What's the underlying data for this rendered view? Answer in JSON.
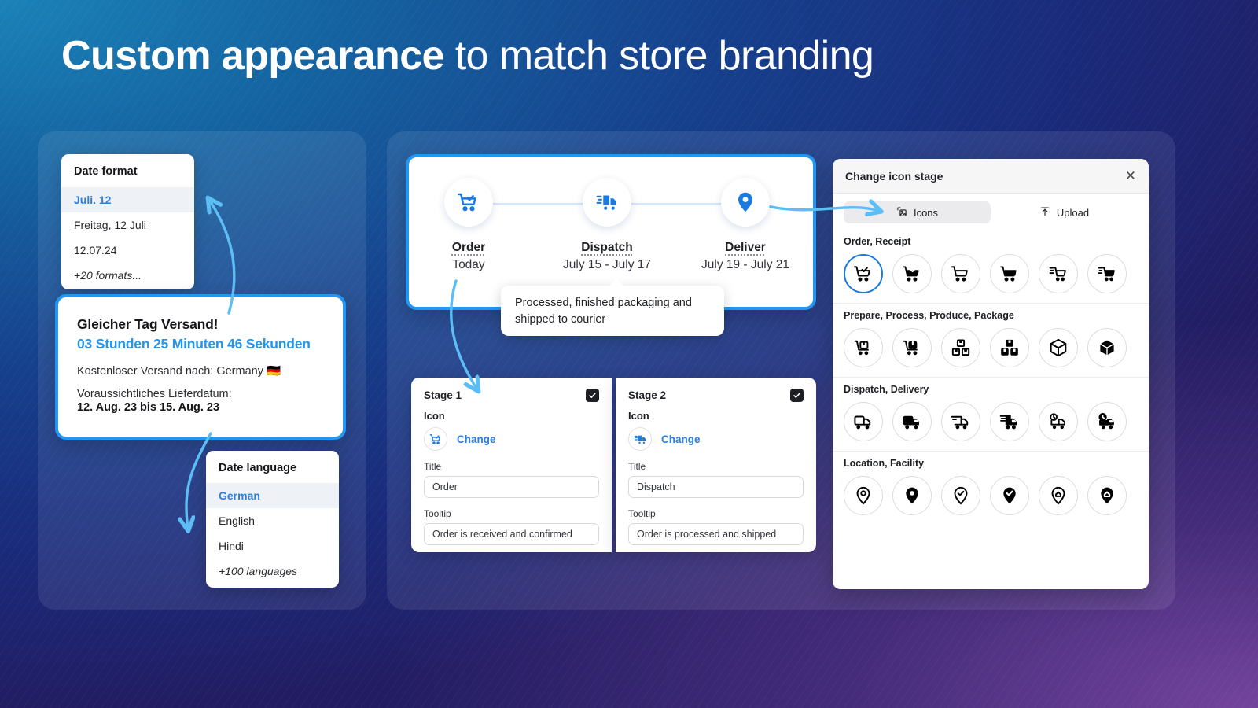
{
  "headline": {
    "bold": "Custom appearance",
    "rest": " to match store branding"
  },
  "colors": {
    "accent_blue": "#2196f3",
    "link_blue": "#2a7fe0",
    "arrow_blue": "#5dbdf5",
    "dark_text": "#1d1f24"
  },
  "date_format": {
    "title": "Date format",
    "options": [
      {
        "label": "Juli. 12",
        "selected": true
      },
      {
        "label": "Freitag, 12 Juli",
        "selected": false
      },
      {
        "label": "12.07.24",
        "selected": false
      },
      {
        "label": "+20 formats...",
        "selected": false
      }
    ]
  },
  "shipping_banner": {
    "heading": "Gleicher Tag Versand!",
    "timer": "03 Stunden 25  Minuten 46 Sekunden",
    "free_shipping": "Kostenloser Versand nach: Germany 🇩🇪",
    "delivery_label": "Voraussichtliches Lieferdatum:",
    "delivery_dates": "12. Aug. 23 bis 15. Aug. 23"
  },
  "date_language": {
    "title": "Date language",
    "options": [
      {
        "label": "German",
        "selected": true
      },
      {
        "label": "English",
        "selected": false
      },
      {
        "label": "Hindi",
        "selected": false
      },
      {
        "label": "+100 languages",
        "selected": false
      }
    ]
  },
  "timeline": {
    "stages": [
      {
        "icon": "cart-check-icon",
        "label": "Order",
        "date": "Today"
      },
      {
        "icon": "delivery-truck-icon",
        "label": "Dispatch",
        "date": "July 15 - July 17"
      },
      {
        "icon": "location-pin-icon",
        "label": "Deliver",
        "date": "July 19 - July 21"
      }
    ],
    "tooltip": "Processed, finished packaging and shipped to courier"
  },
  "stage_editor": [
    {
      "header": "Stage 1",
      "enabled": true,
      "icon_label": "Icon",
      "icon_name": "cart-check-icon",
      "change_label": "Change",
      "title_label": "Title",
      "title_value": "Order",
      "tooltip_label": "Tooltip",
      "tooltip_value": "Order is received and confirmed"
    },
    {
      "header": "Stage 2",
      "enabled": true,
      "icon_label": "Icon",
      "icon_name": "delivery-truck-icon",
      "change_label": "Change",
      "title_label": "Title",
      "title_value": "Dispatch",
      "tooltip_label": "Tooltip",
      "tooltip_value": "Order is processed and shipped"
    }
  ],
  "icon_modal": {
    "title": "Change icon stage",
    "close_label": "✕",
    "tabs": [
      {
        "label": "Icons",
        "icon": "image-icon",
        "active": true
      },
      {
        "label": "Upload",
        "icon": "upload-arrow-icon",
        "active": false
      }
    ],
    "sections": [
      {
        "title": "Order, Receipt",
        "icons": [
          {
            "name": "cart-check-outline-icon",
            "selected": true
          },
          {
            "name": "cart-check-filled-icon",
            "selected": false
          },
          {
            "name": "cart-outline-icon",
            "selected": false
          },
          {
            "name": "cart-filled-icon",
            "selected": false
          },
          {
            "name": "cart-lines-outline-icon",
            "selected": false
          },
          {
            "name": "cart-lines-filled-icon",
            "selected": false
          }
        ]
      },
      {
        "title": "Prepare, Process, Produce, Package",
        "icons": [
          {
            "name": "cart-box-outline-icon",
            "selected": false
          },
          {
            "name": "cart-box-filled-icon",
            "selected": false
          },
          {
            "name": "boxes-stack-outline-icon",
            "selected": false
          },
          {
            "name": "boxes-stack-filled-icon",
            "selected": false
          },
          {
            "name": "package-cube-outline-icon",
            "selected": false
          },
          {
            "name": "package-cube-filled-icon",
            "selected": false
          }
        ]
      },
      {
        "title": "Dispatch, Delivery",
        "icons": [
          {
            "name": "truck-outline-icon",
            "selected": false
          },
          {
            "name": "truck-filled-icon",
            "selected": false
          },
          {
            "name": "truck-speed-outline-icon",
            "selected": false
          },
          {
            "name": "truck-speed-filled-icon",
            "selected": false
          },
          {
            "name": "truck-clock-outline-icon",
            "selected": false
          },
          {
            "name": "truck-clock-filled-icon",
            "selected": false
          }
        ]
      },
      {
        "title": "Location, Facility",
        "icons": [
          {
            "name": "pin-outline-icon",
            "selected": false
          },
          {
            "name": "pin-filled-icon",
            "selected": false
          },
          {
            "name": "pin-check-outline-icon",
            "selected": false
          },
          {
            "name": "pin-check-filled-icon",
            "selected": false
          },
          {
            "name": "pin-home-outline-icon",
            "selected": false
          },
          {
            "name": "pin-home-filled-icon",
            "selected": false
          }
        ]
      }
    ]
  }
}
